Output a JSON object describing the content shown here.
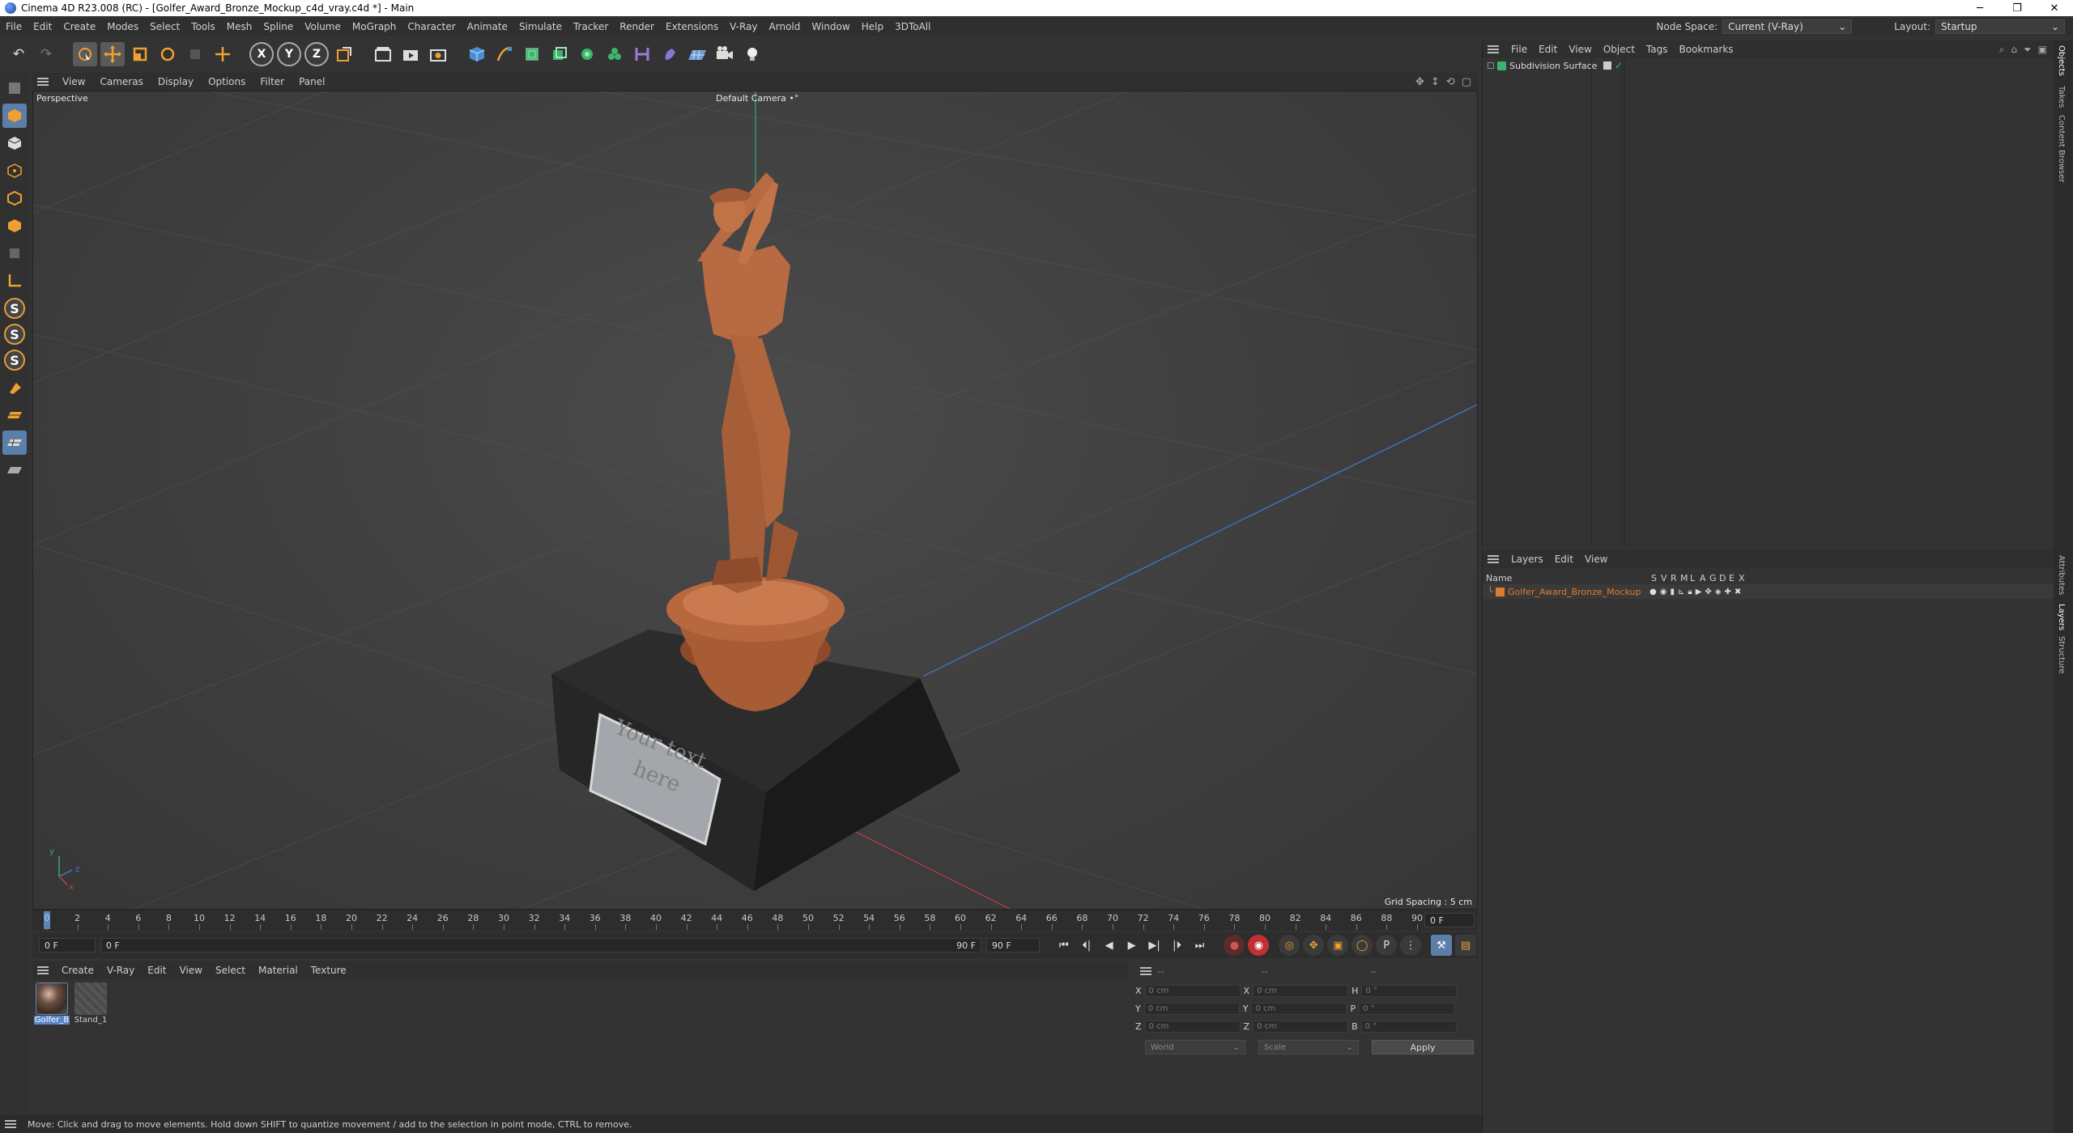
{
  "window": {
    "title": "Cinema 4D R23.008 (RC) - [Golfer_Award_Bronze_Mockup_c4d_vray.c4d *] - Main",
    "min": "─",
    "restore": "❐",
    "close": "✕"
  },
  "menubar": {
    "items": [
      "File",
      "Edit",
      "Create",
      "Modes",
      "Select",
      "Tools",
      "Mesh",
      "Spline",
      "Volume",
      "MoGraph",
      "Character",
      "Animate",
      "Simulate",
      "Tracker",
      "Render",
      "Extensions",
      "V-Ray",
      "Arnold",
      "Window",
      "Help",
      "3DToAll"
    ],
    "node_space_label": "Node Space:",
    "node_space_value": "Current (V-Ray)",
    "layout_label": "Layout:",
    "layout_value": "Startup"
  },
  "toolbar": {
    "undo": "↶",
    "redo": "↷",
    "axis_x": "X",
    "axis_y": "Y",
    "axis_z": "Z"
  },
  "viewport": {
    "menu": [
      "View",
      "Cameras",
      "Display",
      "Options",
      "Filter",
      "Panel"
    ],
    "name": "Perspective",
    "camera": "Default Camera •°",
    "grid_spacing": "Grid Spacing : 5 cm",
    "plaque_text_1": "Your text",
    "plaque_text_2": "here",
    "axis_y": "y",
    "axis_z": "z",
    "axis_x": "x"
  },
  "timeline": {
    "ticks": [
      "0",
      "2",
      "4",
      "6",
      "8",
      "10",
      "12",
      "14",
      "16",
      "18",
      "20",
      "22",
      "24",
      "26",
      "28",
      "30",
      "32",
      "34",
      "36",
      "38",
      "40",
      "42",
      "44",
      "46",
      "48",
      "50",
      "52",
      "54",
      "56",
      "58",
      "60",
      "62",
      "64",
      "66",
      "68",
      "70",
      "72",
      "74",
      "76",
      "78",
      "80",
      "82",
      "84",
      "86",
      "88",
      "90"
    ],
    "current_frame": "0 F",
    "start_field": "0 F",
    "range_start": "0 F",
    "range_end": "90 F",
    "end_field": "90 F"
  },
  "materials": {
    "menu": [
      "Create",
      "V-Ray",
      "Edit",
      "View",
      "Select",
      "Material",
      "Texture"
    ],
    "items": [
      {
        "name": "Golfer_B"
      },
      {
        "name": "Stand_1"
      }
    ]
  },
  "coords": {
    "rows": [
      {
        "l1": "X",
        "v1": "0 cm",
        "l2": "X",
        "v2": "0 cm",
        "l3": "H",
        "v3": "0 °"
      },
      {
        "l1": "Y",
        "v1": "0 cm",
        "l2": "Y",
        "v2": "0 cm",
        "l3": "P",
        "v3": "0 °"
      },
      {
        "l1": "Z",
        "v1": "0 cm",
        "l2": "Z",
        "v2": "0 cm",
        "l3": "B",
        "v3": "0 °"
      }
    ],
    "header_1": "--",
    "header_2": "--",
    "header_3": "--",
    "mode": "World",
    "scale": "Scale",
    "apply": "Apply"
  },
  "status": {
    "text": "Move: Click and drag to move elements. Hold down SHIFT to quantize movement / add to the selection in point mode, CTRL to remove."
  },
  "objects_panel": {
    "menu": [
      "File",
      "Edit",
      "View",
      "Object",
      "Tags",
      "Bookmarks"
    ],
    "items": [
      {
        "name": "Subdivision Surface"
      }
    ]
  },
  "layers_panel": {
    "menu": [
      "Layers",
      "Edit",
      "View"
    ],
    "columns": [
      "Name",
      "S",
      "V",
      "R",
      "M",
      "L",
      "A",
      "G",
      "D",
      "E",
      "X"
    ],
    "items": [
      {
        "name": "Golfer_Award_Bronze_Mockup",
        "color": "#e07a2e"
      }
    ]
  },
  "side_tabs": [
    "Objects",
    "Takes",
    "Content Browser",
    "Attributes",
    "Layers",
    "Structure"
  ],
  "colors": {
    "accent_orange": "#e07a2e",
    "bronze": "#b8683f",
    "selection_blue": "#5a86c5"
  }
}
